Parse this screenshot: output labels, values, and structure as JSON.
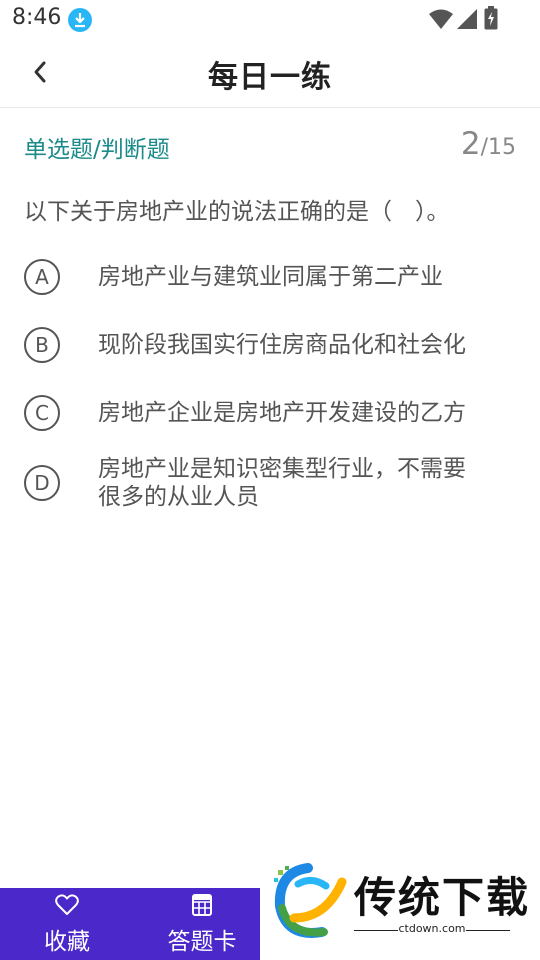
{
  "status_bar": {
    "time": "8:46"
  },
  "header": {
    "title": "每日一练"
  },
  "question": {
    "type_label": "单选题/判断题",
    "current": "2",
    "total": "/15",
    "text": "以下关于房地产业的说法正确的是（　）。",
    "options": [
      {
        "letter": "A",
        "line1": "房地产业与建筑业同属于第二产业",
        "line2": ""
      },
      {
        "letter": "B",
        "line1": "现阶段我国实行住房商品化和社会化",
        "line2": ""
      },
      {
        "letter": "C",
        "line1": "房地产企业是房地产开发建设的乙方",
        "line2": ""
      },
      {
        "letter": "D",
        "line1": "房地产业是知识密集型行业，不需要",
        "line2": "很多的从业人员"
      }
    ]
  },
  "bottom_bar": {
    "favorite_label": "收藏",
    "answer_card_label": "答题卡"
  },
  "watermark": {
    "brand": "传统下载",
    "url": "ctdown.com"
  },
  "colors": {
    "accent_teal": "#1b8a8a",
    "bottom_bar": "#4b28c9",
    "download_badge": "#29b6f6"
  }
}
